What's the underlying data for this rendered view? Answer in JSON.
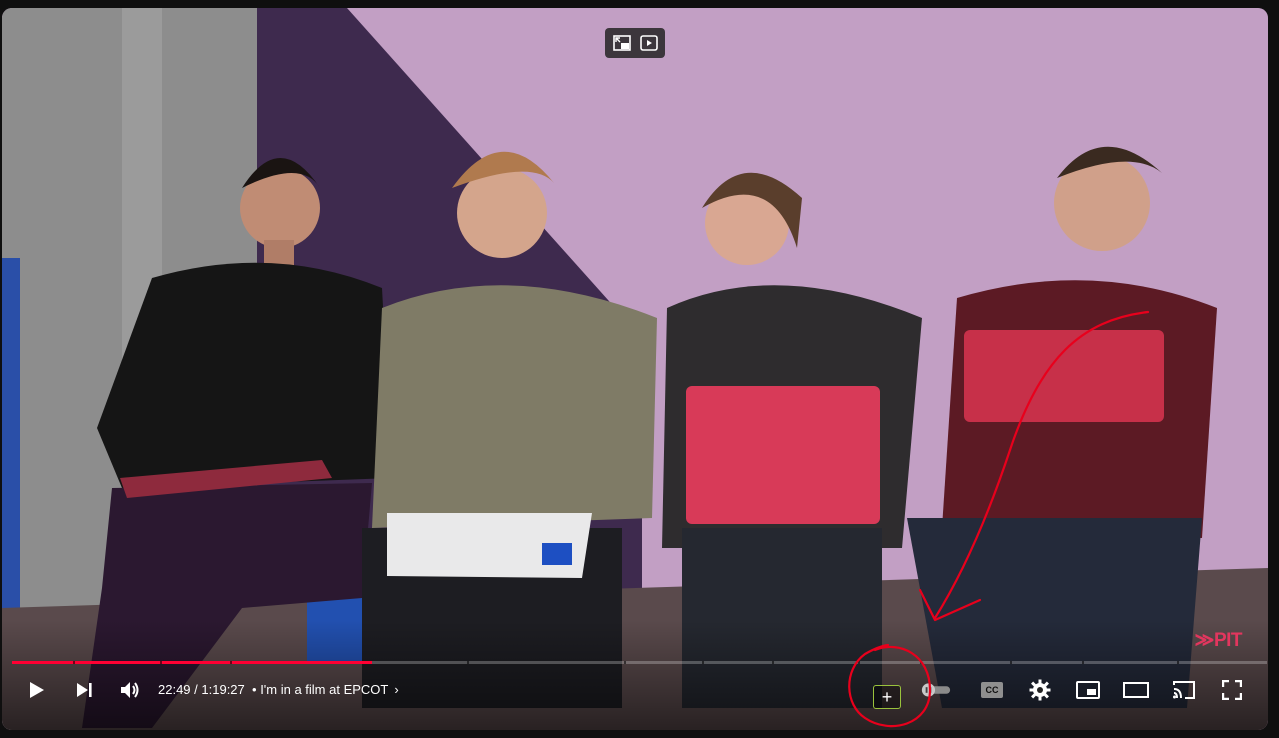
{
  "player": {
    "current_time": "22:49",
    "separator": " / ",
    "duration": "1:19:27",
    "chapter_bullet": "•",
    "chapter_title": "I'm in a film at EPCOT",
    "chapter_chevron": "›",
    "progress_fraction": 0.287,
    "watermark": "≫PIT"
  },
  "controls": {
    "play": "play-icon",
    "next": "next-icon",
    "volume": "volume-icon",
    "add": "+",
    "autoplay": "toggle-icon",
    "captions": "CC",
    "settings": "gear-icon",
    "miniplayer": "miniplayer-icon",
    "theater": "theater-icon",
    "cast": "cast-icon",
    "fullscreen": "fullscreen-icon"
  },
  "colors": {
    "progress": "#ff0033",
    "annotation": "#e8001c",
    "add_border": "#9ac23c"
  }
}
